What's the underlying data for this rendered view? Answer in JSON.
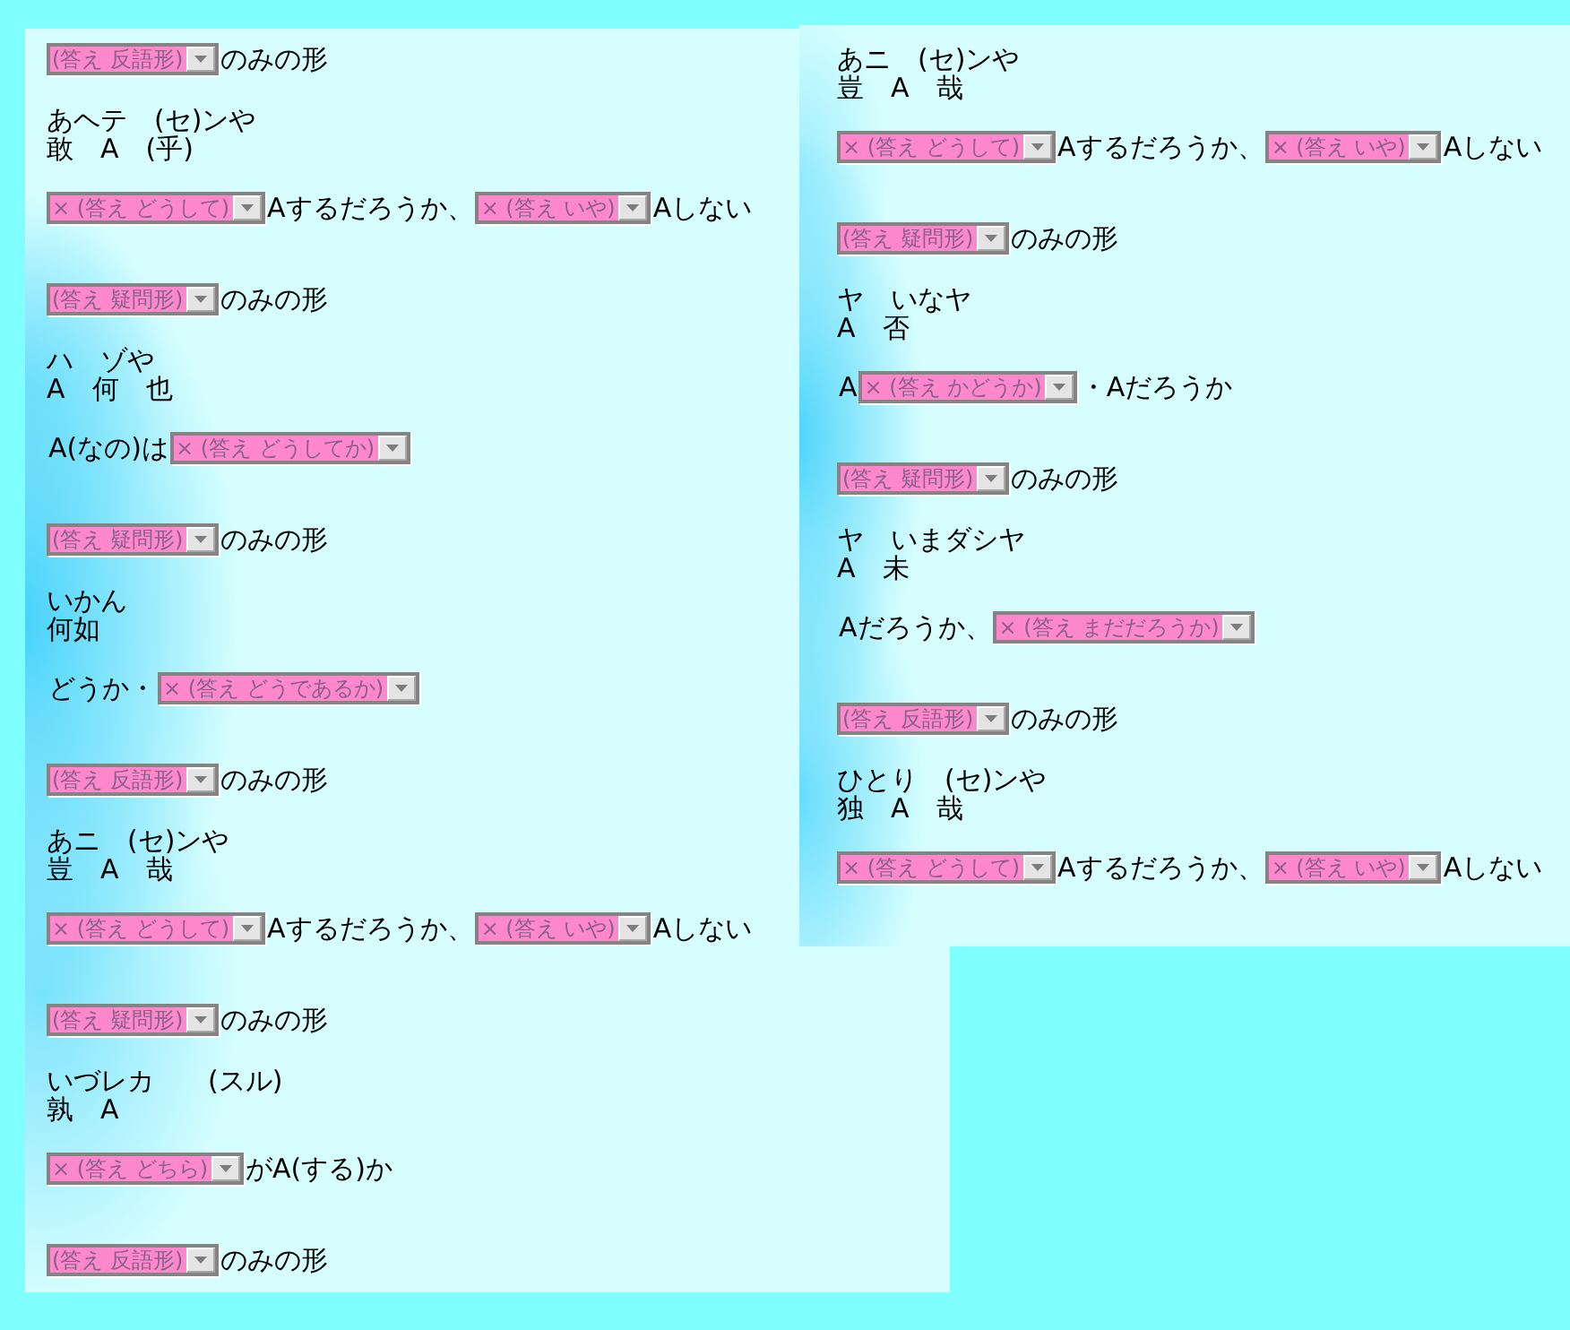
{
  "panels": [
    {
      "items": [
        {
          "kind": "form",
          "parts": [
            {
              "kind": "dropdown",
              "value": "(答え 反語形)"
            },
            {
              "kind": "text",
              "text": "のみの形"
            }
          ]
        },
        {
          "kind": "reading",
          "kana": "あヘテ　(セ)ンや",
          "kanji": "敢　A　(乎)"
        },
        {
          "kind": "answer",
          "parts": [
            {
              "kind": "dropdown",
              "value": "× (答え どうして)"
            },
            {
              "kind": "text",
              "text": "Aするだろうか、"
            },
            {
              "kind": "dropdown",
              "value": "× (答え いや)"
            },
            {
              "kind": "text",
              "text": "Aしない"
            }
          ]
        },
        {
          "kind": "form",
          "parts": [
            {
              "kind": "dropdown",
              "value": "(答え 疑問形)"
            },
            {
              "kind": "text",
              "text": "のみの形"
            }
          ]
        },
        {
          "kind": "reading",
          "kana": "ハ　ゾや",
          "kanji": "A　何　也"
        },
        {
          "kind": "answer",
          "parts": [
            {
              "kind": "text",
              "text": "A(なの)は"
            },
            {
              "kind": "dropdown",
              "value": "× (答え どうしてか)"
            }
          ]
        },
        {
          "kind": "form",
          "parts": [
            {
              "kind": "dropdown",
              "value": "(答え 疑問形)"
            },
            {
              "kind": "text",
              "text": "のみの形"
            }
          ]
        },
        {
          "kind": "reading",
          "kana": "いかん",
          "kanji": "何如"
        },
        {
          "kind": "answer",
          "parts": [
            {
              "kind": "text",
              "text": "どうか・"
            },
            {
              "kind": "dropdown",
              "value": "× (答え どうであるか)"
            }
          ]
        },
        {
          "kind": "form",
          "parts": [
            {
              "kind": "dropdown",
              "value": "(答え 反語形)"
            },
            {
              "kind": "text",
              "text": "のみの形"
            }
          ]
        },
        {
          "kind": "reading",
          "kana": "あニ　(セ)ンや",
          "kanji": "豈　A　哉"
        },
        {
          "kind": "answer",
          "parts": [
            {
              "kind": "dropdown",
              "value": "× (答え どうして)"
            },
            {
              "kind": "text",
              "text": "Aするだろうか、"
            },
            {
              "kind": "dropdown",
              "value": "× (答え いや)"
            },
            {
              "kind": "text",
              "text": "Aしない"
            }
          ]
        },
        {
          "kind": "form",
          "parts": [
            {
              "kind": "dropdown",
              "value": "(答え 疑問形)"
            },
            {
              "kind": "text",
              "text": "のみの形"
            }
          ]
        },
        {
          "kind": "reading",
          "kana": "いづレカ　　(スル)",
          "kanji": "孰　A"
        },
        {
          "kind": "answer",
          "parts": [
            {
              "kind": "dropdown",
              "value": "× (答え どちら)"
            },
            {
              "kind": "text",
              "text": "がA(する)か"
            }
          ]
        },
        {
          "kind": "form",
          "parts": [
            {
              "kind": "dropdown",
              "value": "(答え 反語形)"
            },
            {
              "kind": "text",
              "text": "のみの形"
            }
          ]
        }
      ]
    },
    {
      "items": [
        {
          "kind": "reading",
          "kana": "あニ　(セ)ンや",
          "kanji": "豈　A　哉"
        },
        {
          "kind": "answer",
          "parts": [
            {
              "kind": "dropdown",
              "value": "× (答え どうして)"
            },
            {
              "kind": "text",
              "text": "Aするだろうか、"
            },
            {
              "kind": "dropdown",
              "value": "× (答え いや)"
            },
            {
              "kind": "text",
              "text": "Aしない"
            }
          ]
        },
        {
          "kind": "form",
          "parts": [
            {
              "kind": "dropdown",
              "value": "(答え 疑問形)"
            },
            {
              "kind": "text",
              "text": "のみの形"
            }
          ]
        },
        {
          "kind": "reading",
          "kana": "ヤ　いなヤ",
          "kanji": "A　否"
        },
        {
          "kind": "answer",
          "parts": [
            {
              "kind": "text",
              "text": "A"
            },
            {
              "kind": "dropdown",
              "value": "× (答え かどうか)"
            },
            {
              "kind": "text",
              "text": "・Aだろうか"
            }
          ]
        },
        {
          "kind": "form",
          "parts": [
            {
              "kind": "dropdown",
              "value": "(答え 疑問形)"
            },
            {
              "kind": "text",
              "text": "のみの形"
            }
          ]
        },
        {
          "kind": "reading",
          "kana": "ヤ　いまダシヤ",
          "kanji": "A　未"
        },
        {
          "kind": "answer",
          "parts": [
            {
              "kind": "text",
              "text": "Aだろうか、"
            },
            {
              "kind": "dropdown",
              "value": "× (答え まだだろうか)"
            }
          ]
        },
        {
          "kind": "form",
          "parts": [
            {
              "kind": "dropdown",
              "value": "(答え 反語形)"
            },
            {
              "kind": "text",
              "text": "のみの形"
            }
          ]
        },
        {
          "kind": "reading",
          "kana": "ひとり　(セ)ンや",
          "kanji": "独　A　哉"
        },
        {
          "kind": "answer",
          "parts": [
            {
              "kind": "dropdown",
              "value": "× (答え どうして)"
            },
            {
              "kind": "text",
              "text": "Aするだろうか、"
            },
            {
              "kind": "dropdown",
              "value": "× (答え いや)"
            },
            {
              "kind": "text",
              "text": "Aしない"
            }
          ]
        }
      ]
    }
  ]
}
